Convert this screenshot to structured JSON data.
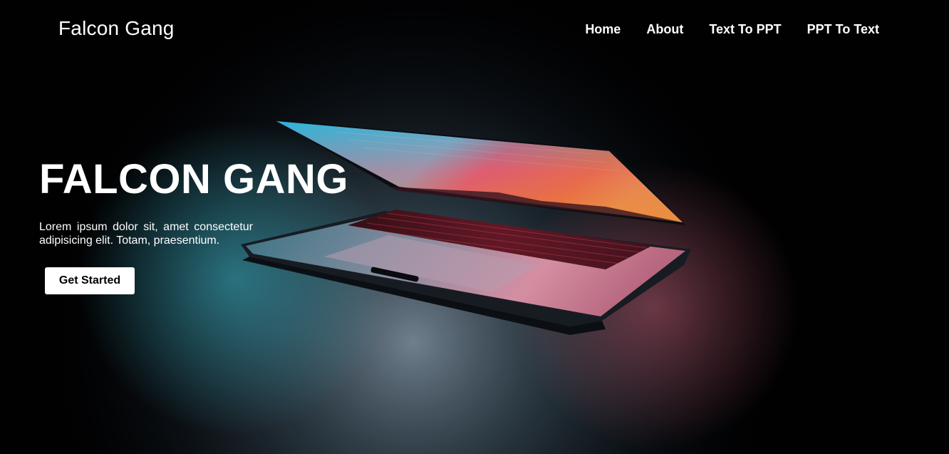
{
  "nav": {
    "brand": "Falcon Gang",
    "links": [
      "Home",
      "About",
      "Text To PPT",
      "PPT To Text"
    ]
  },
  "hero": {
    "title": "FALCON GANG",
    "text": "Lorem ipsum dolor sit, amet consectetur adipisicing elit. Totam, praesentium.",
    "button_label": "Get Started",
    "background_image": "laptop-photo"
  },
  "colors": {
    "background": "#020203",
    "text": "#ffffff",
    "button_bg": "#ffffff",
    "button_text": "#000000"
  }
}
